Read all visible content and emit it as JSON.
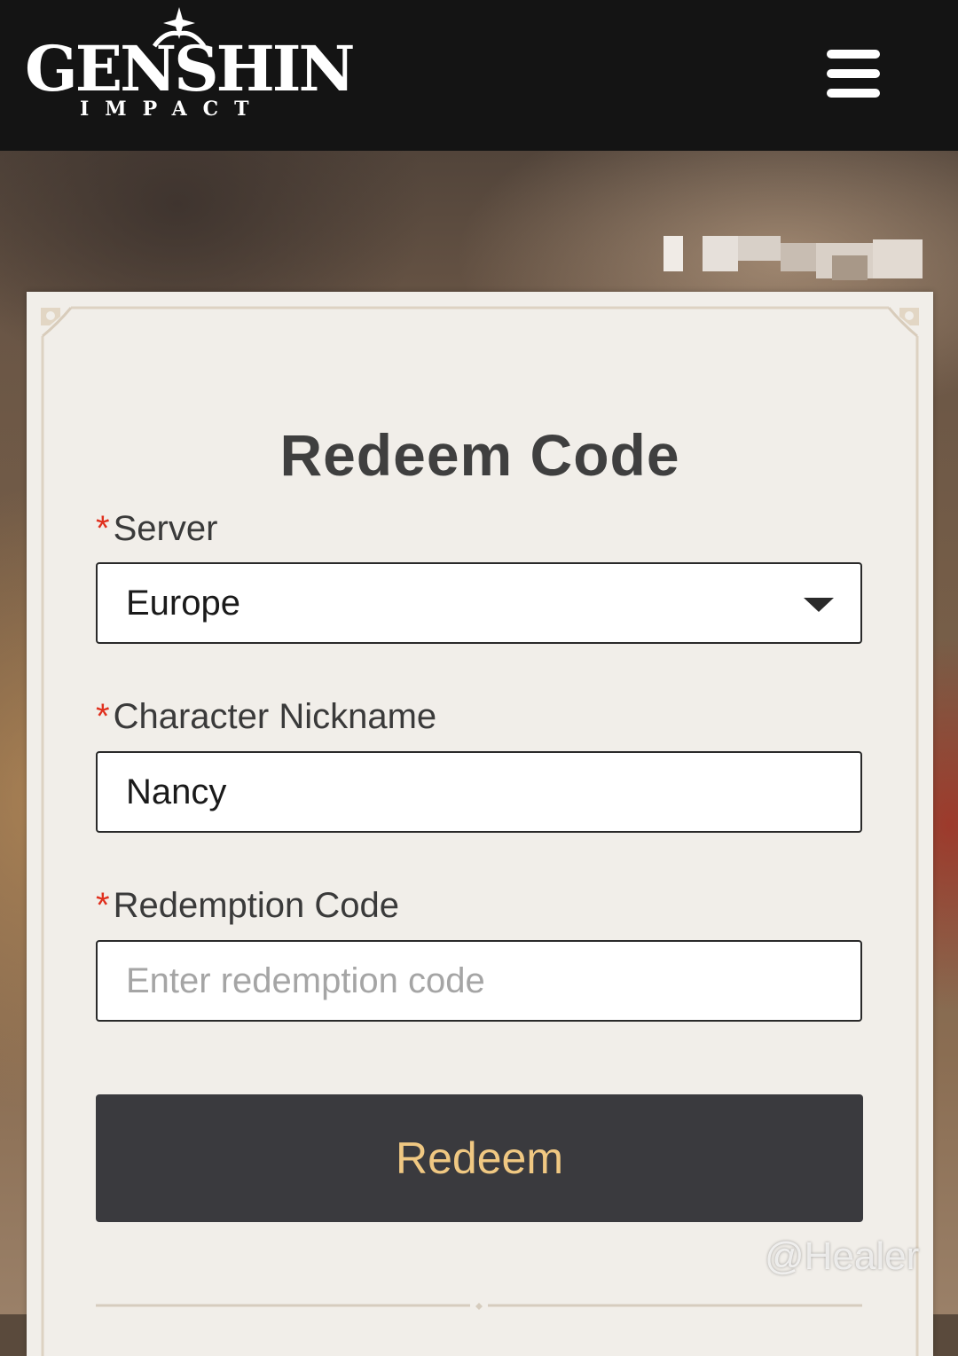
{
  "header": {
    "logo_word": "GENSHIN",
    "logo_sub": "IMPACT",
    "menu_icon": "hamburger-menu-icon"
  },
  "form": {
    "title": "Redeem Code",
    "required_marker": "*",
    "server": {
      "label": "Server",
      "value": "Europe"
    },
    "nickname": {
      "label": "Character Nickname",
      "value": "Nancy"
    },
    "code": {
      "label": "Redemption Code",
      "placeholder": "Enter redemption code"
    },
    "submit_label": "Redeem"
  },
  "watermark": "@Healer",
  "colors": {
    "header_bg": "#141414",
    "card_bg": "#f1eee9",
    "required": "#e0301e",
    "button_bg": "#3a3a3e",
    "button_text": "#f0c882"
  }
}
